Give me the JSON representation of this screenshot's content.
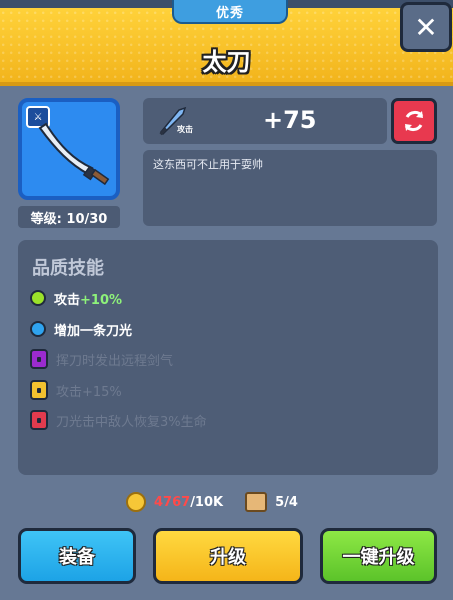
{
  "header": {
    "rarity_label": "优秀",
    "title": "太刀",
    "close_label": "✕"
  },
  "item": {
    "level_text": "等级: 10/30",
    "stat_value": "+75",
    "stat_tag": "攻击",
    "description": "这东西可不止用于耍帅"
  },
  "skills": {
    "title": "品质技能",
    "rows": [
      {
        "prefix": "攻击",
        "highlight": "+10%",
        "text": "",
        "unlocked": true,
        "color": "#9be22a"
      },
      {
        "prefix": "",
        "highlight": "",
        "text": "增加一条刀光",
        "unlocked": true,
        "color": "#2fa3ef"
      },
      {
        "prefix": "",
        "highlight": "",
        "text": "挥刀时发出远程剑气",
        "unlocked": false,
        "color": "#9b2bd0"
      },
      {
        "prefix": "",
        "highlight": "",
        "text": "攻击+15%",
        "unlocked": false,
        "color": "#f3c22f"
      },
      {
        "prefix": "",
        "highlight": "",
        "text": "刀光击中敌人恢复3%生命",
        "unlocked": false,
        "color": "#e23b4e"
      }
    ]
  },
  "cost": {
    "coins_current": "4767",
    "coins_required": "/10K",
    "scrolls": "5/4"
  },
  "buttons": {
    "equip": "装备",
    "upgrade": "升级",
    "one_click_upgrade": "一键升级"
  }
}
